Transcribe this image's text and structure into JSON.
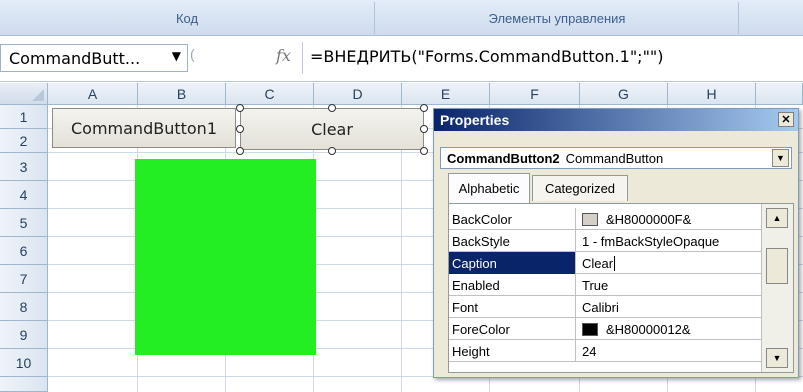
{
  "ribbon": {
    "groups": [
      {
        "label": "Код"
      },
      {
        "label": "Элементы управления"
      }
    ]
  },
  "formula_bar": {
    "name_box": "CommandButt...",
    "fx_label": "fx",
    "formula": "=ВНЕДРИТЬ(\"Forms.CommandButton.1\";\"\")"
  },
  "sheet": {
    "columns": [
      "A",
      "B",
      "C",
      "D",
      "E",
      "F",
      "G",
      "H"
    ],
    "rows": [
      "1",
      "2",
      "3",
      "4",
      "5",
      "6",
      "7",
      "8",
      "9",
      "10"
    ],
    "buttons": [
      {
        "label": "CommandButton1"
      },
      {
        "label": "Clear"
      }
    ],
    "colors": {
      "green_shape": "#22ee22"
    }
  },
  "properties_window": {
    "title": "Properties",
    "object_name": "CommandButton2",
    "object_type": "CommandButton",
    "tabs": [
      "Alphabetic",
      "Categorized"
    ],
    "active_tab": "Alphabetic",
    "rows": [
      {
        "name": "BackColor",
        "value": "&H8000000F&",
        "swatch": "#d4d0c8"
      },
      {
        "name": "BackStyle",
        "value": "1 - fmBackStyleOpaque"
      },
      {
        "name": "Caption",
        "value": "Clear",
        "selected": true
      },
      {
        "name": "Enabled",
        "value": "True"
      },
      {
        "name": "Font",
        "value": "Calibri"
      },
      {
        "name": "ForeColor",
        "value": "&H80000012&",
        "swatch": "#000000"
      },
      {
        "name": "Height",
        "value": "24"
      }
    ]
  }
}
